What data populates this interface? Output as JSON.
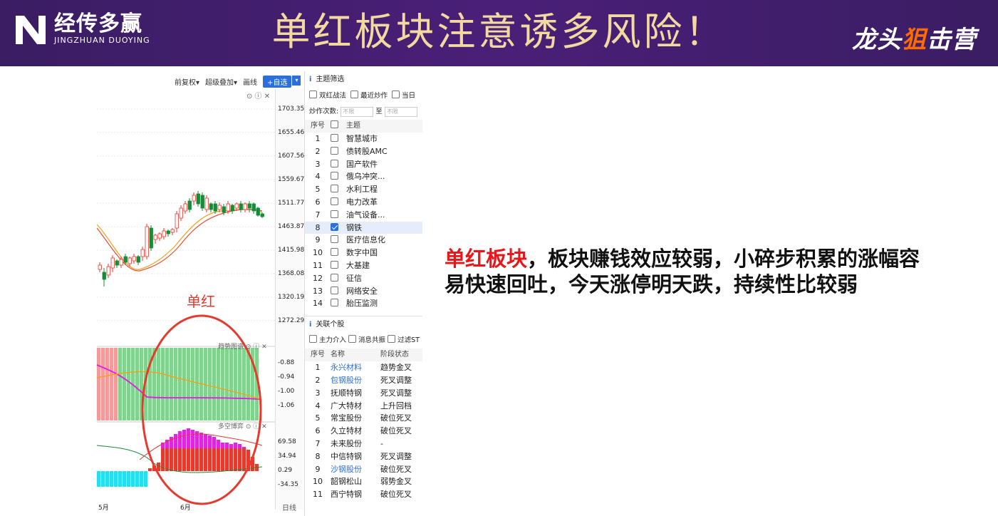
{
  "banner": {
    "logo_cn": "经传多赢",
    "logo_en": "JINGZHUAN DUOYING",
    "title": "单红板块注意诱多风险！",
    "brand_right_pre": "龙头",
    "brand_right_x": "狙",
    "brand_right_post": "击营"
  },
  "toolbar": {
    "qfq": "前复权▾",
    "overlay": "超级叠加▾",
    "draw": "画线",
    "add": "+自选",
    "dd": "▾"
  },
  "price_axis": [
    "1703.35",
    "1655.46",
    "1607.56",
    "1559.67",
    "1511.77",
    "1463.87",
    "1415.98",
    "1368.08",
    "1320.19",
    "1272.29"
  ],
  "trend_axis": [
    "-0.88",
    "-0.94",
    "-1.00",
    "-1.06"
  ],
  "duokong_axis": [
    "69.58",
    "34.94",
    "0.29",
    "-34.35"
  ],
  "x_labels": {
    "may": "5月",
    "jun": "6月",
    "rixian": "日线"
  },
  "panel_labels": {
    "trend": "趋势图谱",
    "duokong": "多空博弈"
  },
  "annotation_label": "单红",
  "colors": {
    "up": "#e53a2e",
    "down": "#1a8a3a",
    "green_bar": "#7fd38c",
    "pink_bar": "#f49a9a",
    "magenta": "#e025e0",
    "ma_orange": "#f0a020",
    "ma_red": "#e0503a",
    "circle": "#e53a2e"
  },
  "theme_panel": {
    "header": "主题筛选",
    "filters": [
      "双红战法",
      "最近炒作",
      "当日"
    ],
    "count_label": "炒作次数:",
    "min_placeholder": "不限",
    "to": "至",
    "max_placeholder": "不限",
    "col_num": "序号",
    "col_theme": "主题",
    "rows": [
      {
        "n": "1",
        "name": "智慧城市"
      },
      {
        "n": "2",
        "name": "债转股AMC"
      },
      {
        "n": "3",
        "name": "国产软件"
      },
      {
        "n": "4",
        "name": "俄乌冲突..."
      },
      {
        "n": "5",
        "name": "水利工程"
      },
      {
        "n": "6",
        "name": "电力改革"
      },
      {
        "n": "7",
        "name": "油气设备..."
      },
      {
        "n": "8",
        "name": "钢铁"
      },
      {
        "n": "9",
        "name": "医疗信息化"
      },
      {
        "n": "10",
        "name": "数字中国"
      },
      {
        "n": "11",
        "name": "大基建"
      },
      {
        "n": "12",
        "name": "征信"
      },
      {
        "n": "13",
        "name": "网络安全"
      },
      {
        "n": "14",
        "name": "胎压监测"
      }
    ]
  },
  "stock_panel": {
    "header": "关联个股",
    "filters": [
      "主力介入",
      "消息共振",
      "过滤ST"
    ],
    "col_num": "序号",
    "col_name": "名称",
    "col_state": "阶段状态",
    "rows": [
      {
        "n": "1",
        "name": "永兴材料",
        "state": "趋势金叉"
      },
      {
        "n": "2",
        "name": "包钢股份",
        "state": "死叉调整"
      },
      {
        "n": "3",
        "name": "抚顺特钢",
        "state": "死叉调整"
      },
      {
        "n": "4",
        "name": "广大特材",
        "state": "上升回档"
      },
      {
        "n": "5",
        "name": "常宝股份",
        "state": "破位死叉"
      },
      {
        "n": "6",
        "name": "久立特材",
        "state": "破位死叉"
      },
      {
        "n": "7",
        "name": "未来股份",
        "state": "-"
      },
      {
        "n": "8",
        "name": "中信特钢",
        "state": "死叉调整"
      },
      {
        "n": "9",
        "name": "沙钢股份",
        "state": "破位死叉"
      },
      {
        "n": "10",
        "name": "韶钢松山",
        "state": "弱势金叉"
      },
      {
        "n": "11",
        "name": "西宁特钢",
        "state": "破位死叉"
      }
    ]
  },
  "annotation": {
    "red": "单红板块",
    "line1": "，板块赚钱效应较弱，小碎步积累的涨幅容",
    "line2": "易快速回吐，今天涨停明天跌，持续性比较弱"
  }
}
